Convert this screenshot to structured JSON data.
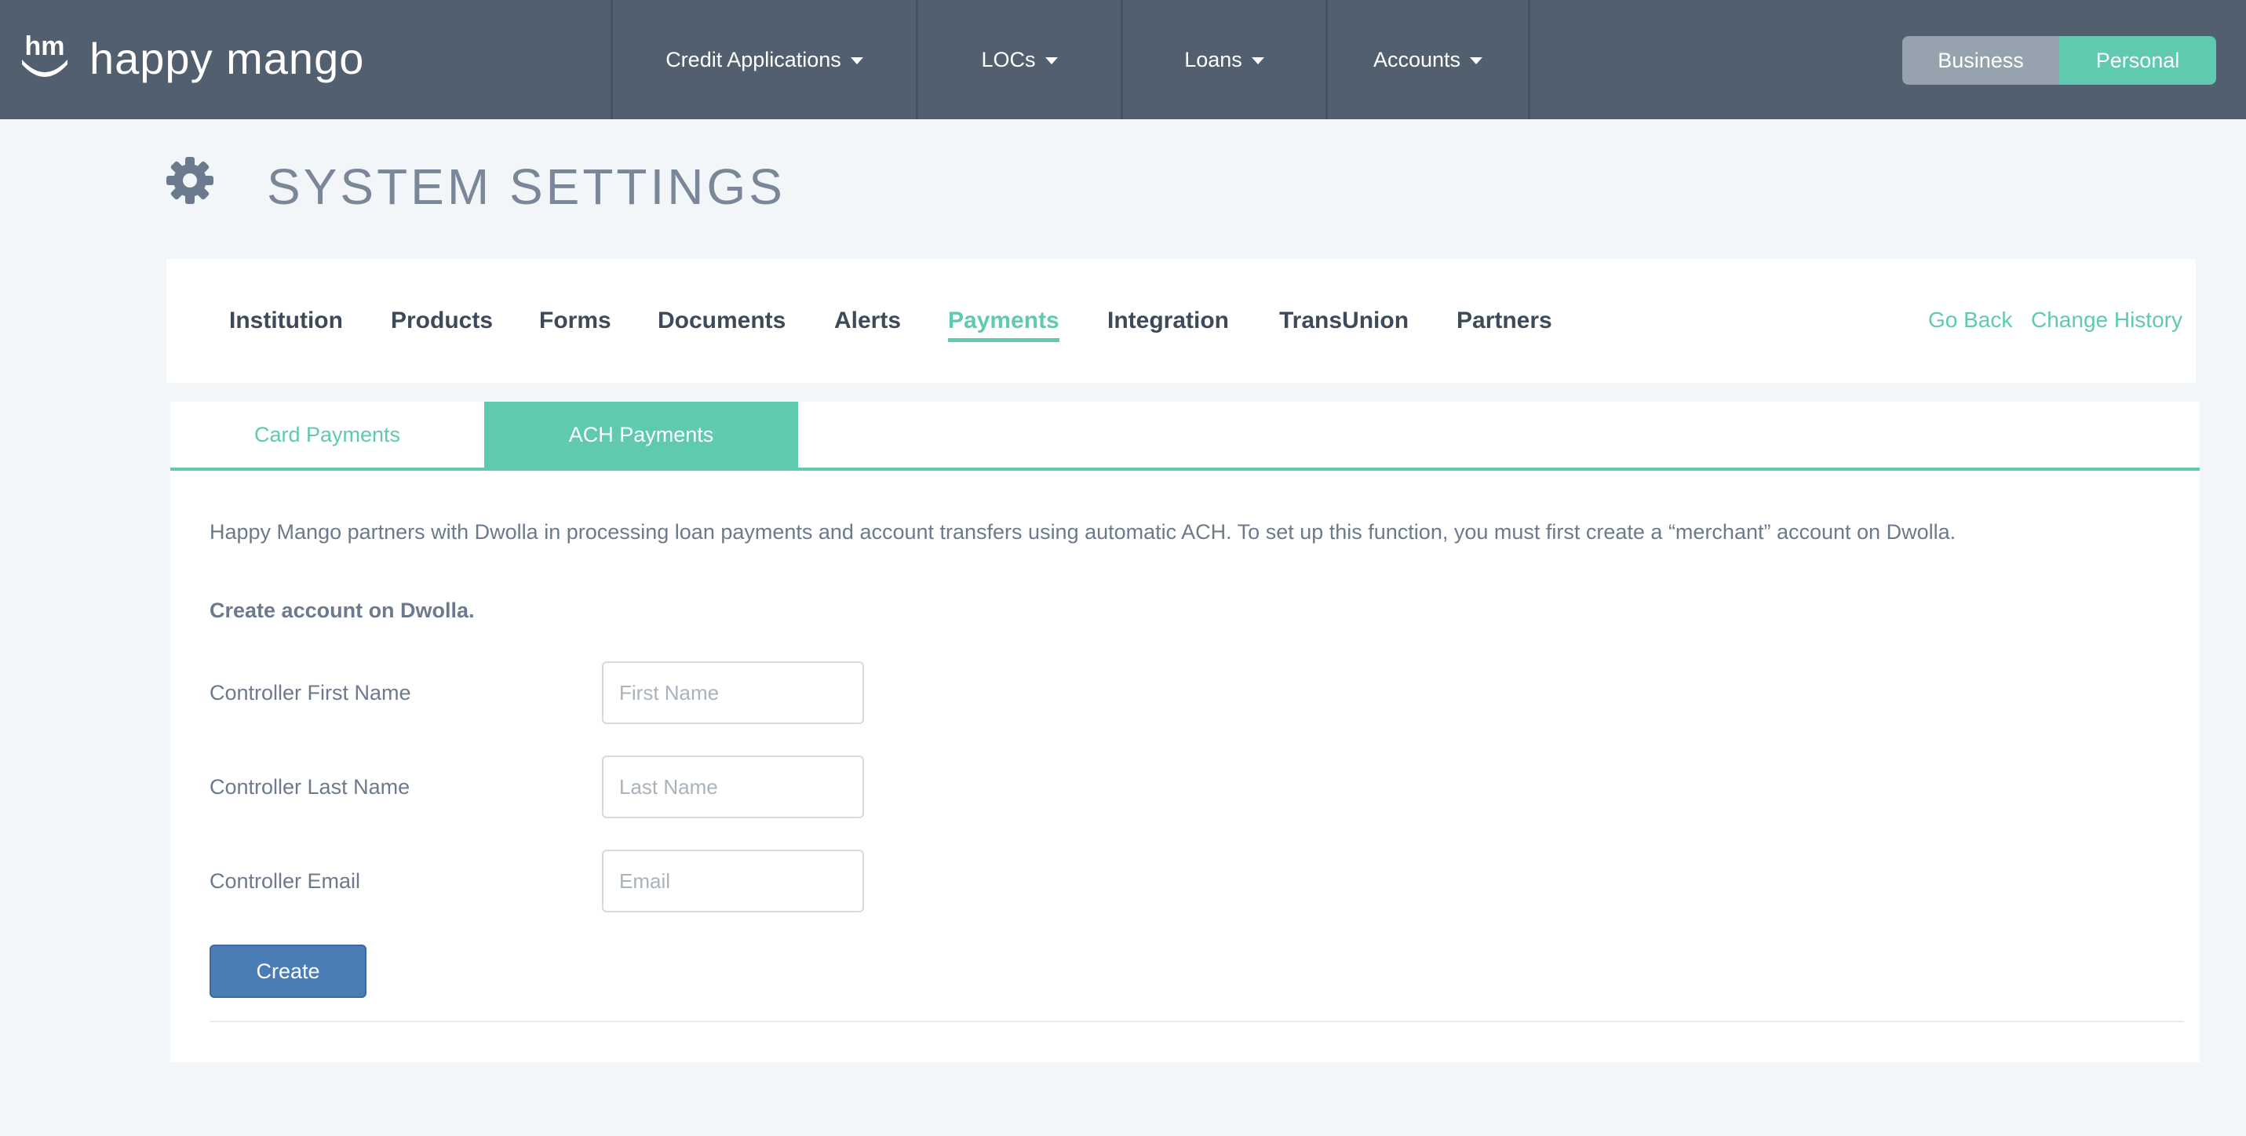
{
  "brand": {
    "name": "happy mango",
    "logo_text": "hm"
  },
  "nav": {
    "items": [
      {
        "label": "Credit Applications"
      },
      {
        "label": "LOCs"
      },
      {
        "label": "Loans"
      },
      {
        "label": "Accounts"
      }
    ]
  },
  "mode_toggle": {
    "business_label": "Business",
    "personal_label": "Personal",
    "active": "Personal"
  },
  "page": {
    "title": "SYSTEM SETTINGS"
  },
  "settings_tabs": {
    "items": [
      {
        "label": "Institution"
      },
      {
        "label": "Products"
      },
      {
        "label": "Forms"
      },
      {
        "label": "Documents"
      },
      {
        "label": "Alerts"
      },
      {
        "label": "Payments"
      },
      {
        "label": "Integration"
      },
      {
        "label": "TransUnion"
      },
      {
        "label": "Partners"
      }
    ],
    "active": "Payments",
    "go_back_label": "Go Back",
    "change_history_label": "Change History"
  },
  "payment_tabs": {
    "card_label": "Card Payments",
    "ach_label": "ACH Payments",
    "active": "ACH Payments"
  },
  "ach": {
    "intro": "Happy Mango partners with Dwolla in processing loan payments and account transfers using automatic ACH. To set up this function, you must first create a “merchant” account on Dwolla.",
    "section_heading": "Create account on Dwolla.",
    "fields": [
      {
        "label": "Controller First Name",
        "placeholder": "First Name",
        "value": ""
      },
      {
        "label": "Controller Last Name",
        "placeholder": "Last Name",
        "value": ""
      },
      {
        "label": "Controller Email",
        "placeholder": "Email",
        "value": ""
      }
    ],
    "create_label": "Create"
  },
  "colors": {
    "topbar": "#515f6f",
    "accent": "#5fcab0",
    "primary_button": "#4a7db5",
    "background": "#f2f6f8"
  }
}
